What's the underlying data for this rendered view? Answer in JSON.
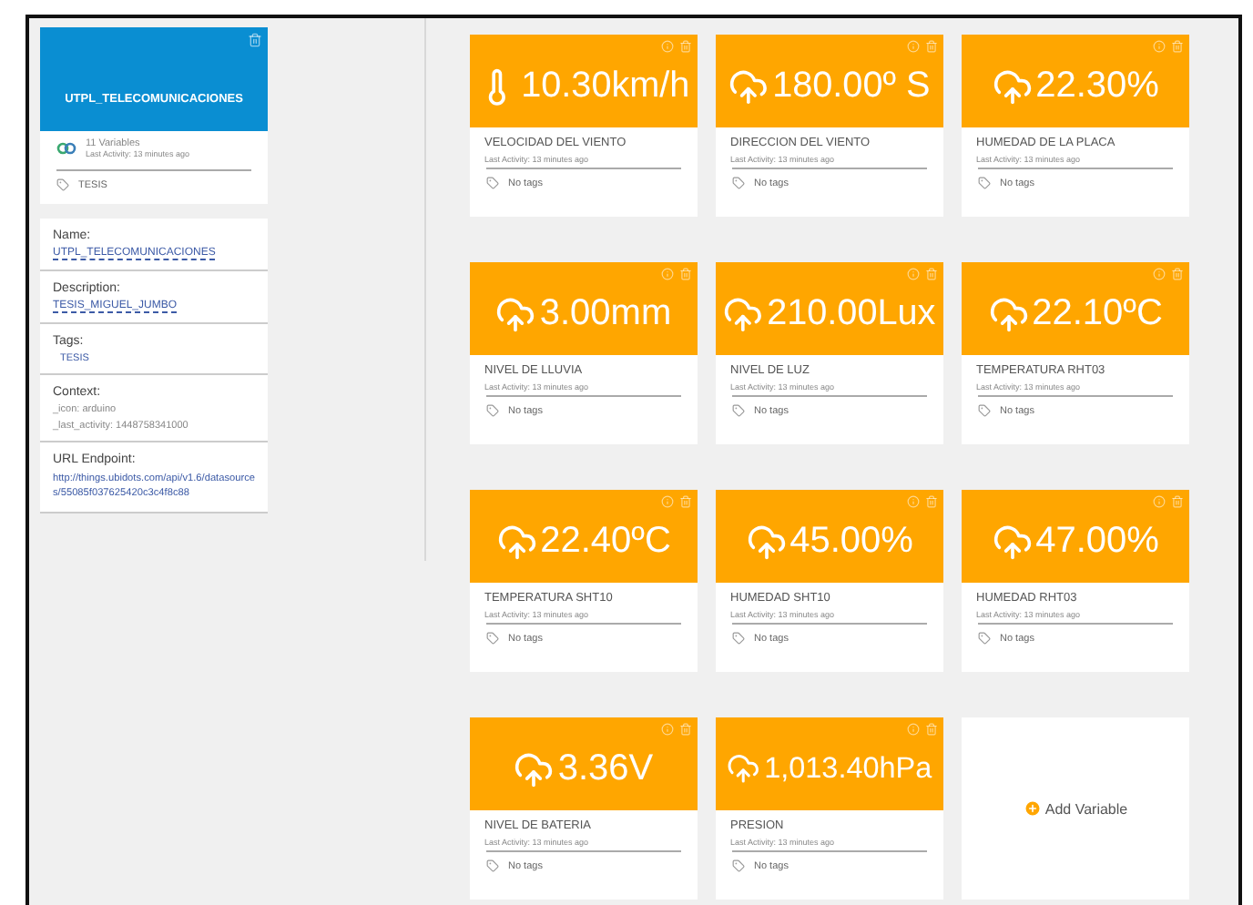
{
  "device": {
    "name": "UTPL_TELECOMUNICACIONES",
    "variables_count": "11 Variables",
    "last_activity": "Last Activity: 13 minutes ago",
    "tag": "TESIS"
  },
  "details": [
    {
      "kind": "link",
      "label": "Name:",
      "value": "UTPL_TELECOMUNICACIONES"
    },
    {
      "kind": "link",
      "label": "Description:",
      "value": "TESIS_MIGUEL_JUMBO"
    },
    {
      "kind": "tag",
      "label": "Tags:",
      "value": "TESIS"
    },
    {
      "kind": "context",
      "label": "Context:",
      "entries": [
        {
          "key": "_icon:",
          "value": "arduino"
        },
        {
          "key": "_last_activity:",
          "value": "1448758341000"
        }
      ]
    },
    {
      "kind": "url",
      "label": "URL Endpoint:",
      "value": "http://things.ubidots.com/api/v1.6/datasources/55085f037625420c3c4f8c88"
    }
  ],
  "variables": [
    {
      "kind": "thermometer",
      "value": "10.30km/h",
      "name": "VELOCIDAD DEL VIENTO",
      "last_activity": "Last Activity: 13 minutes ago",
      "tags": "No tags"
    },
    {
      "kind": "cloud",
      "value": "180.00º S",
      "name": "DIRECCION DEL VIENTO",
      "last_activity": "Last Activity: 13 minutes ago",
      "tags": "No tags"
    },
    {
      "kind": "cloud",
      "value": "22.30%",
      "name": "HUMEDAD DE LA PLACA",
      "last_activity": "Last Activity: 13 minutes ago",
      "tags": "No tags"
    },
    {
      "kind": "cloud",
      "value": "3.00mm",
      "name": "NIVEL DE LLUVIA",
      "last_activity": "Last Activity: 13 minutes ago",
      "tags": "No tags"
    },
    {
      "kind": "cloud",
      "value": "210.00Lux",
      "name": "NIVEL DE LUZ",
      "last_activity": "Last Activity: 13 minutes ago",
      "tags": "No tags"
    },
    {
      "kind": "cloud",
      "value": "22.10ºC",
      "name": "TEMPERATURA RHT03",
      "last_activity": "Last Activity: 13 minutes ago",
      "tags": "No tags"
    },
    {
      "kind": "cloud",
      "value": "22.40ºC",
      "name": "TEMPERATURA SHT10",
      "last_activity": "Last Activity: 13 minutes ago",
      "tags": "No tags"
    },
    {
      "kind": "cloud",
      "value": "45.00%",
      "name": "HUMEDAD SHT10",
      "last_activity": "Last Activity: 13 minutes ago",
      "tags": "No tags"
    },
    {
      "kind": "cloud",
      "value": "47.00%",
      "name": "HUMEDAD RHT03",
      "last_activity": "Last Activity: 13 minutes ago",
      "tags": "No tags"
    },
    {
      "kind": "cloud",
      "value": "3.36V",
      "name": "NIVEL DE BATERIA",
      "last_activity": "Last Activity: 13 minutes ago",
      "tags": "No tags"
    },
    {
      "kind": "cloud",
      "value": "1,013.40hPa",
      "name": "PRESION",
      "last_activity": "Last Activity: 13 minutes ago",
      "tags": "No tags"
    }
  ],
  "add_variable": "Add Variable"
}
